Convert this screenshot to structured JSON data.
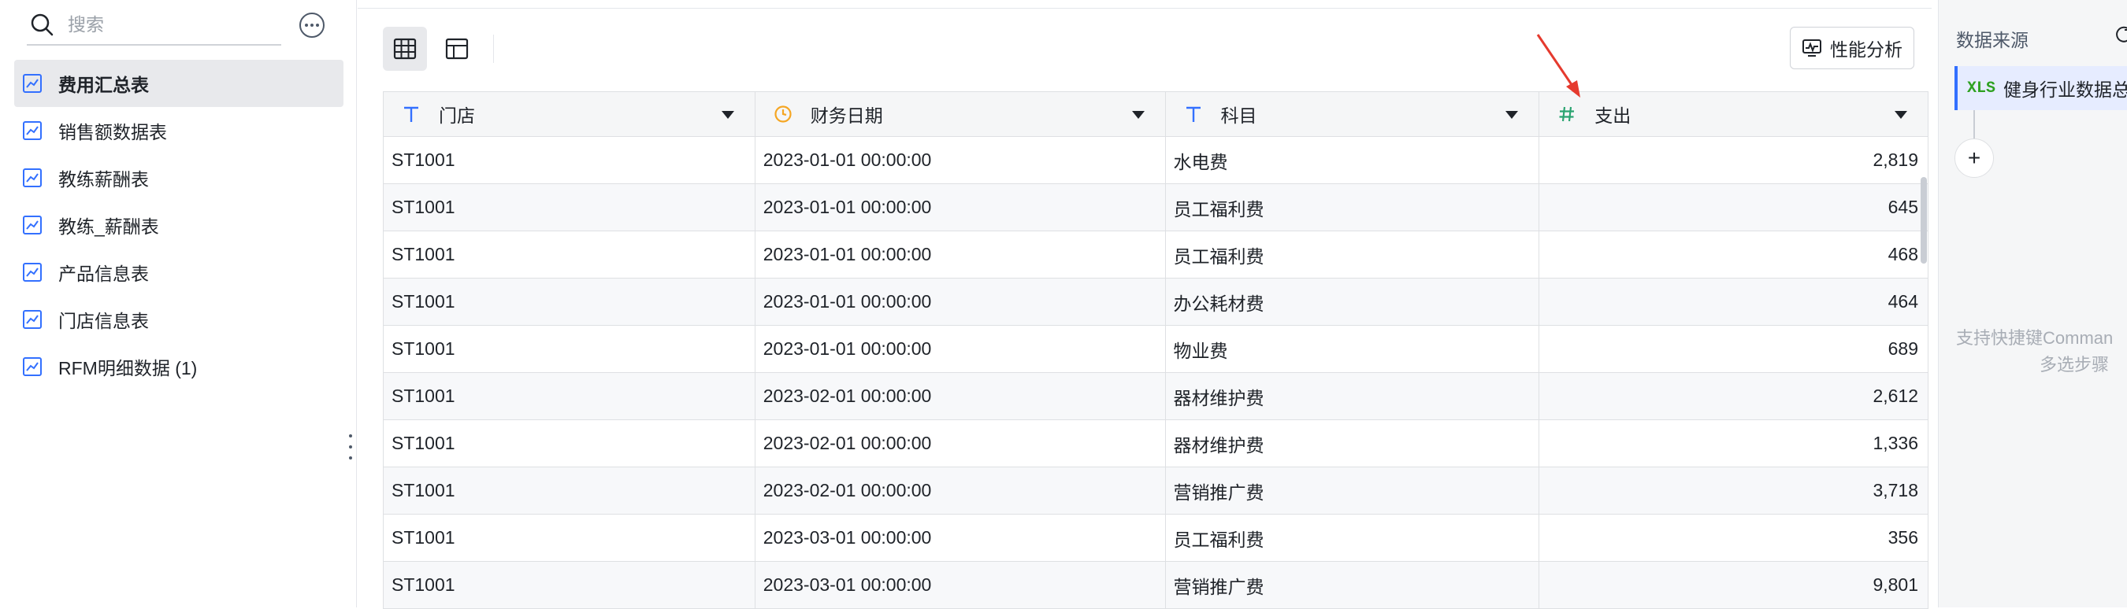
{
  "sidebar": {
    "search": {
      "placeholder": "搜索"
    },
    "items": [
      {
        "label": "费用汇总表",
        "active": true
      },
      {
        "label": "销售额数据表"
      },
      {
        "label": "教练薪酬表"
      },
      {
        "label": "教练_薪酬表"
      },
      {
        "label": "产品信息表"
      },
      {
        "label": "门店信息表"
      },
      {
        "label": "RFM明细数据 (1)"
      }
    ]
  },
  "toolbar": {
    "perf_label": "性能分析"
  },
  "table": {
    "columns": [
      {
        "label": "门店",
        "type": "text",
        "icon": "text-type-icon"
      },
      {
        "label": "财务日期",
        "type": "datetime",
        "icon": "clock-icon"
      },
      {
        "label": "科目",
        "type": "text",
        "icon": "text-type-icon"
      },
      {
        "label": "支出",
        "type": "number",
        "icon": "hash-icon"
      }
    ],
    "rows": [
      [
        "ST1001",
        "2023-01-01 00:00:00",
        "水电费",
        "2,819"
      ],
      [
        "ST1001",
        "2023-01-01 00:00:00",
        "员工福利费",
        "645"
      ],
      [
        "ST1001",
        "2023-01-01 00:00:00",
        "员工福利费",
        "468"
      ],
      [
        "ST1001",
        "2023-01-01 00:00:00",
        "办公耗材费",
        "464"
      ],
      [
        "ST1001",
        "2023-01-01 00:00:00",
        "物业费",
        "689"
      ],
      [
        "ST1001",
        "2023-02-01 00:00:00",
        "器材维护费",
        "2,612"
      ],
      [
        "ST1001",
        "2023-02-01 00:00:00",
        "器材维护费",
        "1,336"
      ],
      [
        "ST1001",
        "2023-02-01 00:00:00",
        "营销推广费",
        "3,718"
      ],
      [
        "ST1001",
        "2023-03-01 00:00:00",
        "员工福利费",
        "356"
      ],
      [
        "ST1001",
        "2023-03-01 00:00:00",
        "营销推广费",
        "9,801"
      ]
    ]
  },
  "right_panel": {
    "title": "数据来源",
    "source": {
      "icon": "XLS",
      "label": "健身行业数据总"
    },
    "add_label": "+",
    "hint_line1": "支持快捷键Comman",
    "hint_line2": "多选步骤"
  },
  "colors": {
    "accent": "#3370ff",
    "text_type_icon": "#3370ff",
    "date_icon": "#f5a623",
    "number_icon": "#2ba471",
    "arrow": "#e53a2e",
    "xls_green": "#2ea121"
  }
}
